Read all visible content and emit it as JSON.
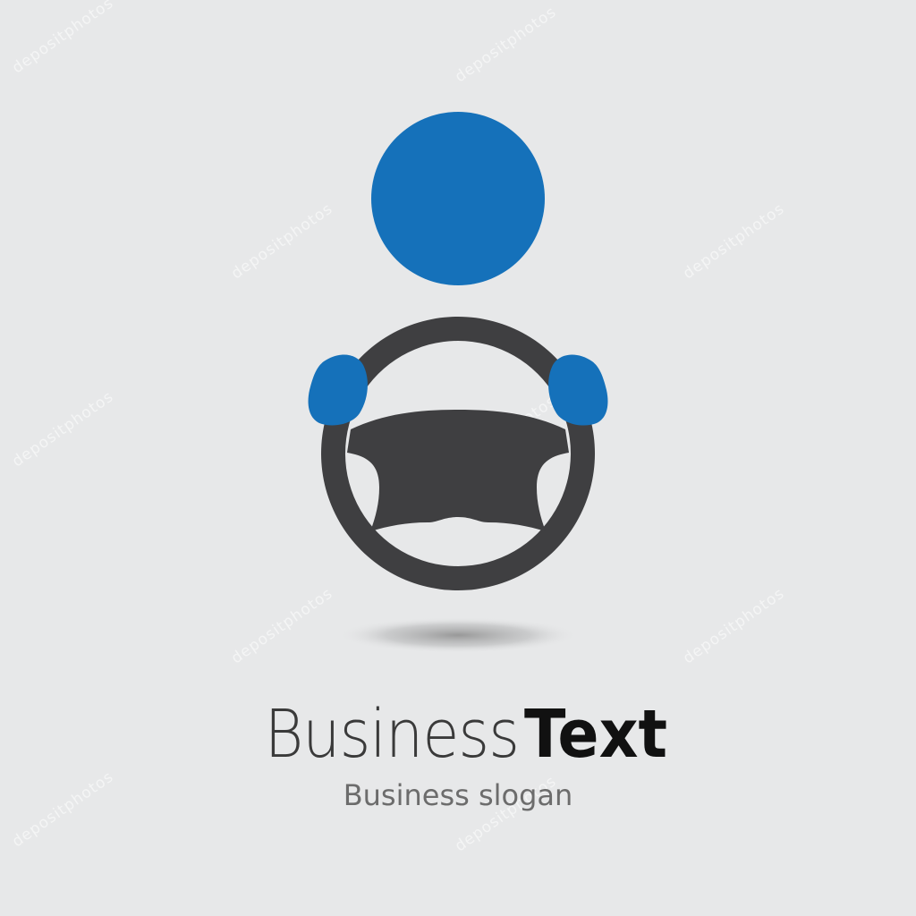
{
  "logo": {
    "title": "Business",
    "title_bold": "Text",
    "slogan": "Business slogan",
    "head_color": "#1571ba",
    "hand_color": "#1571ba",
    "wheel_color": "#3f3f41",
    "shadow_color": "#8a8a8a",
    "icons": [
      "person-head-icon",
      "steering-wheel-icon",
      "left-hand-icon",
      "right-hand-icon"
    ]
  },
  "watermark": {
    "text": "depositphotos"
  }
}
